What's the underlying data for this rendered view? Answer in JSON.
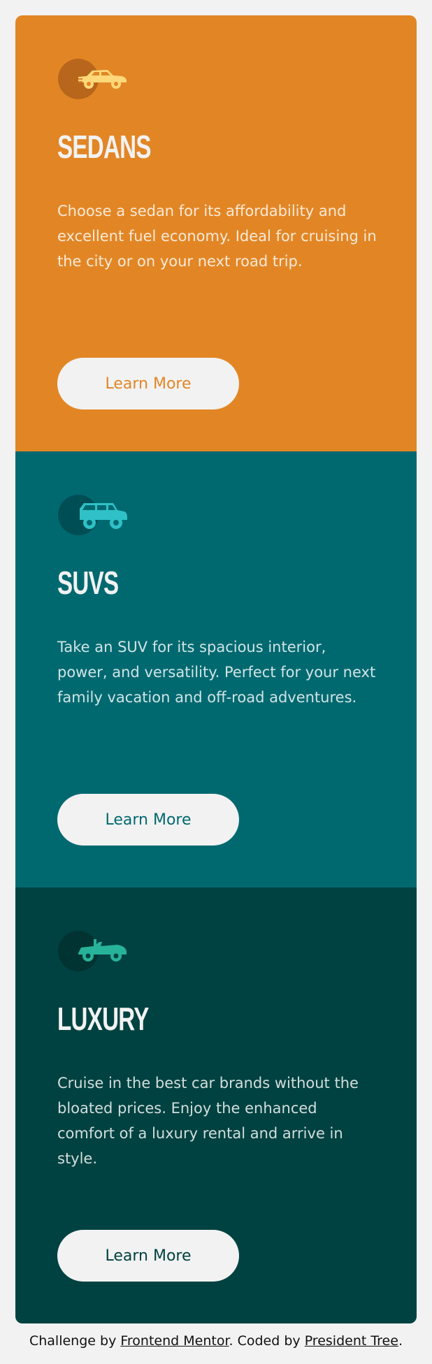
{
  "cards": [
    {
      "icon": "sedan-car-icon",
      "title": "SEDANS",
      "description": "Choose a sedan for its affordability and excellent fuel economy. Ideal for cruising in the city or on your next road trip.",
      "button_label": "Learn More",
      "background": "#e28625",
      "icon_color": "#ffd87a",
      "icon_circle": "#b8661c"
    },
    {
      "icon": "suv-car-icon",
      "title": "SUVS",
      "description": "Take an SUV for its spacious interior, power, and versatility. Perfect for your next family vacation and off-road adventures.",
      "button_label": "Learn More",
      "background": "#006970",
      "icon_color": "#2fc1c7",
      "icon_circle": "#004e55"
    },
    {
      "icon": "luxury-car-icon",
      "title": "LUXURY",
      "description": "Cruise in the best car brands without the bloated prices. Enjoy the enhanced comfort of a luxury rental and arrive in style.",
      "button_label": "Learn More",
      "background": "#004241",
      "icon_color": "#27b39a",
      "icon_circle": "#003331"
    }
  ],
  "attribution": {
    "prefix": "Challenge by ",
    "link1": "Frontend Mentor",
    "middle": ". Coded by ",
    "link2": "President Tree",
    "suffix": "."
  }
}
